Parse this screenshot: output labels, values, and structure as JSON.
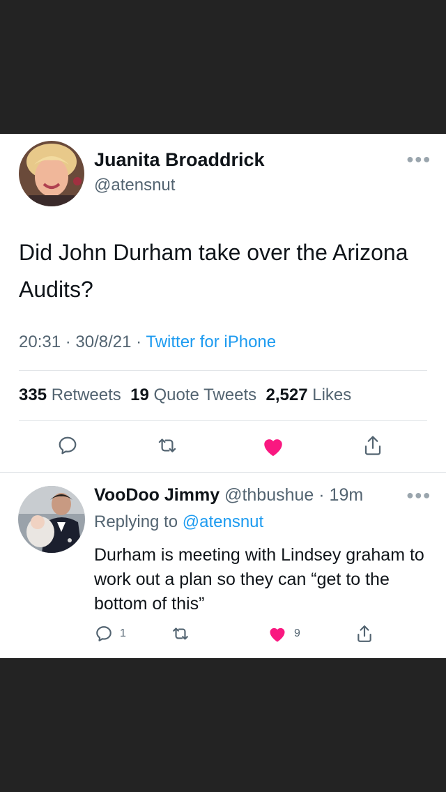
{
  "tweet": {
    "author_name": "Juanita Broaddrick",
    "author_handle": "@atensnut",
    "more_icon": "more-horizontal-icon",
    "text": "Did John Durham take over the Arizona Audits?",
    "time": "20:31",
    "date": "30/8/21",
    "separator": " · ",
    "source": "Twitter for iPhone",
    "stats": {
      "retweets_count": "335",
      "retweets_label": "Retweets",
      "quotes_count": "19",
      "quotes_label": "Quote Tweets",
      "likes_count": "2,527",
      "likes_label": "Likes"
    },
    "actions": [
      "reply-icon",
      "retweet-icon",
      "like-icon-filled",
      "share-icon"
    ],
    "like_color": "#f91880"
  },
  "reply": {
    "author_name": "VooDoo Jimmy",
    "author_handle": "@thbushue",
    "time_ago": "· 19m",
    "replying_prefix": "Replying to",
    "replying_to": "@atensnut",
    "text": "Durham is meeting with Lindsey graham to work out a plan so they can “get to the bottom of this”",
    "reply_count": "1",
    "like_count": "9"
  },
  "colors": {
    "background": "#232323",
    "card": "#ffffff",
    "link": "#1d9bf0",
    "secondary_text": "#536471"
  }
}
